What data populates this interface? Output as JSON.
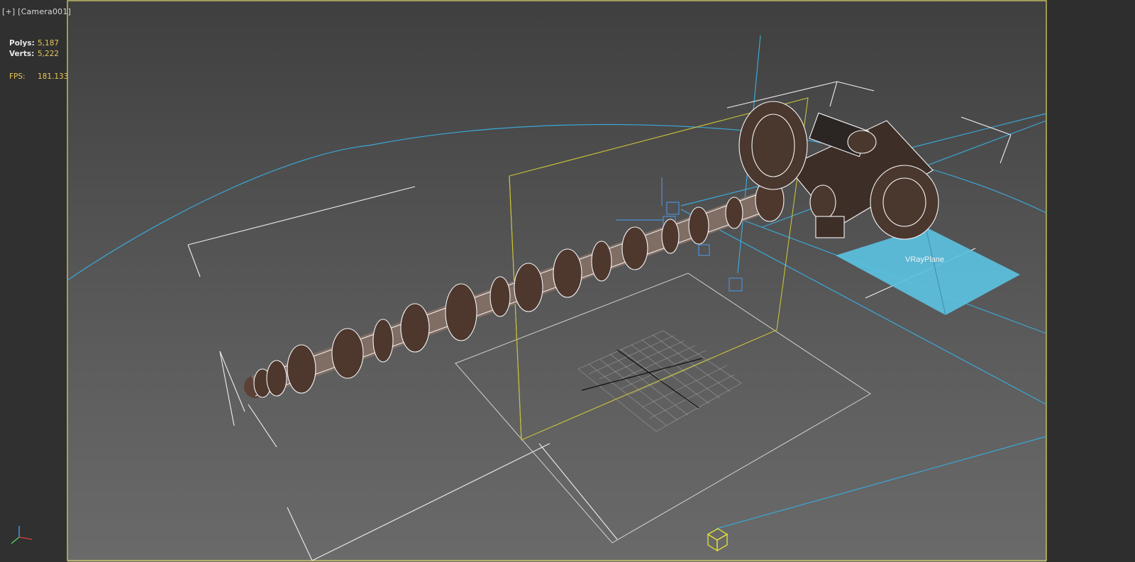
{
  "viewport": {
    "menu_label": "[+]",
    "camera_label": "[Camera001]"
  },
  "stats": {
    "polys_label": "Polys:",
    "polys_value": "5,187",
    "verts_label": "Verts:",
    "verts_value": "5,222",
    "fps_label": "FPS:",
    "fps_value": "181.133"
  },
  "scene": {
    "object_label": "VRayPlane"
  },
  "colors": {
    "viewport_border": "#e1d86a",
    "wireframe": "#f2f2f2",
    "camera_lines": "#3aa8d8",
    "vray_plane": "#5bc1df",
    "cam_target": "#e8e23a"
  }
}
